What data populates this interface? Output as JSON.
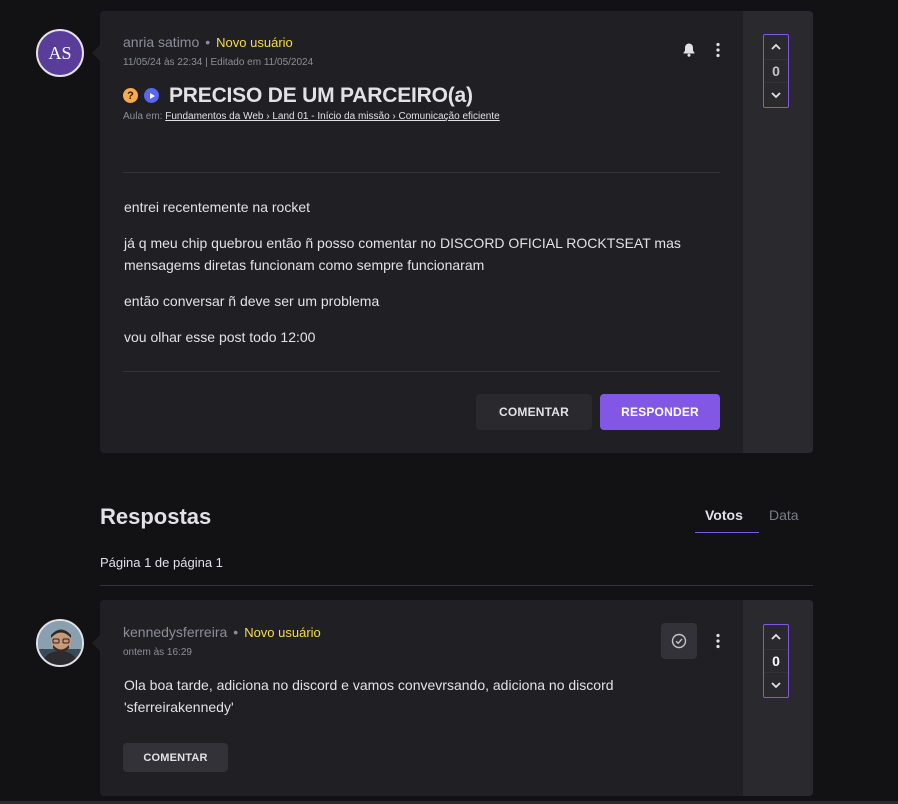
{
  "post": {
    "avatar_initials": "AS",
    "author": "anria satimo",
    "separator": "•",
    "badge": "Novo usuário",
    "meta": "11/05/24 às 22:34 | Editado em 11/05/2024",
    "title": "PRECISO DE UM PARCEIRO(a)",
    "lesson_prefix": "Aula em:",
    "lesson_path": "Fundamentos da Web › Land 01 - Início da missão › Comunicação eficiente",
    "paragraphs": [
      "entrei recentemente na rocket",
      "já q meu chip quebrou então ñ posso comentar no DISCORD OFICIAL ROCKTSEAT mas mensagems diretas funcionam como sempre funcionaram",
      "então conversar ñ deve ser um problema",
      "vou olhar esse post todo 12:00"
    ],
    "comment_label": "COMENTAR",
    "reply_label": "RESPONDER",
    "votes": "0",
    "icons": [
      "question-icon",
      "play-icon",
      "bell-icon",
      "more-icon",
      "chevron-up-icon",
      "chevron-down-icon"
    ]
  },
  "answers": {
    "heading": "Respostas",
    "tabs": [
      "Votos",
      "Data"
    ],
    "pagination": "Página 1 de página 1"
  },
  "reply": {
    "author": "kennedysferreira",
    "separator": "•",
    "badge": "Novo usuário",
    "meta": "ontem às 16:29",
    "text": "Ola boa tarde, adiciona no discord e vamos convevrsando, adiciona no discord 'sferreirakennedy'",
    "comment_label": "COMENTAR",
    "votes": "0",
    "icons": [
      "check-circle-icon",
      "more-icon",
      "chevron-up-icon",
      "chevron-down-icon"
    ]
  },
  "colors": {
    "background": "#121214",
    "card": "#202024",
    "accent": "#8257e5",
    "badge": "#f7dd43",
    "avatar_bg": "#5a3d9a"
  }
}
